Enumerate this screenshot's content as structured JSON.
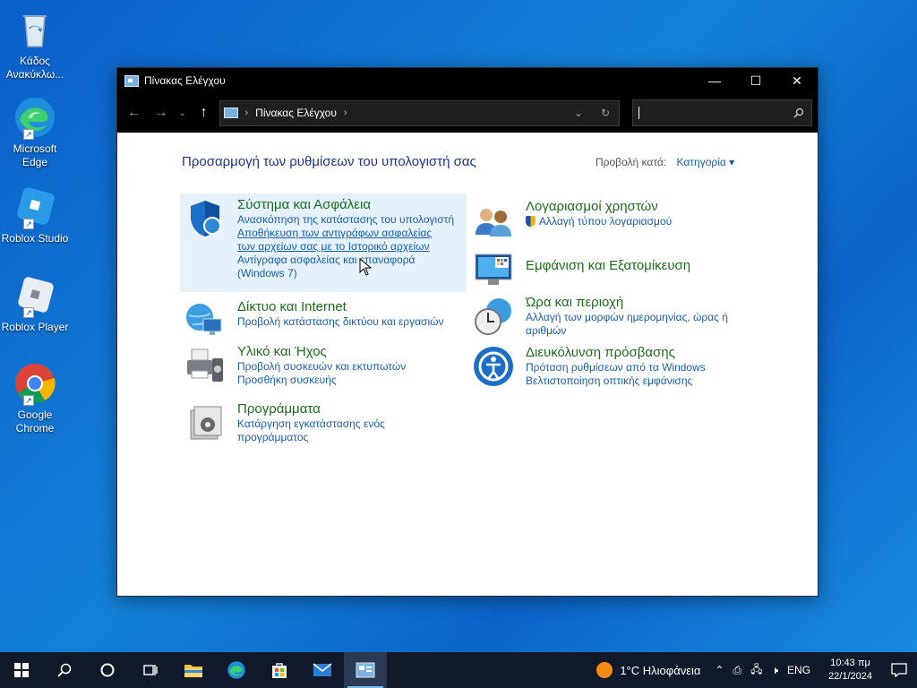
{
  "desktop": {
    "icons": [
      {
        "name": "recycle-bin",
        "label": "Κάδος Ανακύκλω..."
      },
      {
        "name": "microsoft-edge",
        "label": "Microsoft Edge"
      },
      {
        "name": "roblox-studio",
        "label": "Roblox Studio"
      },
      {
        "name": "roblox-player",
        "label": "Roblox Player"
      },
      {
        "name": "google-chrome",
        "label": "Google Chrome"
      }
    ]
  },
  "window": {
    "title": "Πίνακας Ελέγχου",
    "controls": {
      "minimize": "—",
      "maximize": "☐",
      "close": "✕"
    },
    "address": {
      "crumb": "Πίνακας Ελέγχου"
    },
    "search": {
      "placeholder": ""
    }
  },
  "content": {
    "heading": "Προσαρμογή των ρυθμίσεων του υπολογιστή σας",
    "view_by_label": "Προβολή κατά:",
    "view_by_value": "Κατηγορία",
    "categories_left": [
      {
        "title": "Σύστημα και Ασφάλεια",
        "links": [
          "Ανασκόπηση της κατάστασης του υπολογιστή",
          "Αποθήκευση των αντιγράφων ασφαλείας των αρχείων σας με το Ιστορικό αρχείων",
          "Αντίγραφα ασφαλείας και επαναφορά (Windows 7)"
        ]
      },
      {
        "title": "Δίκτυο και Internet",
        "links": [
          "Προβολή κατάστασης δικτύου και εργασιών"
        ]
      },
      {
        "title": "Υλικό και Ήχος",
        "links": [
          "Προβολή συσκευών και εκτυπωτών",
          "Προσθήκη συσκευής"
        ]
      },
      {
        "title": "Προγράμματα",
        "links": [
          "Κατάργηση εγκατάστασης ενός προγράμματος"
        ]
      }
    ],
    "categories_right": [
      {
        "title": "Λογαριασμοί χρηστών",
        "links": [
          "Αλλαγή τύπου λογαριασμού"
        ]
      },
      {
        "title": "Εμφάνιση και Εξατομίκευση",
        "links": []
      },
      {
        "title": "Ώρα και περιοχή",
        "links": [
          "Αλλαγή των μορφών ημερομηνίας, ώρας ή αριθμών"
        ]
      },
      {
        "title": "Διευκόλυνση πρόσβασης",
        "links": [
          "Πρόταση ρυθμίσεων από τα Windows",
          "Βελτιστοποίηση οπτικής εμφάνισης"
        ]
      }
    ]
  },
  "taskbar": {
    "weather": "1°C  Ηλιοφάνεια",
    "language": "ENG",
    "time": "10:43 πμ",
    "date": "22/1/2024"
  },
  "colors": {
    "category_title": "#1e6c1e",
    "link": "#1a5ea8",
    "heading": "#1e3287",
    "highlight": "#e5f1fb"
  }
}
